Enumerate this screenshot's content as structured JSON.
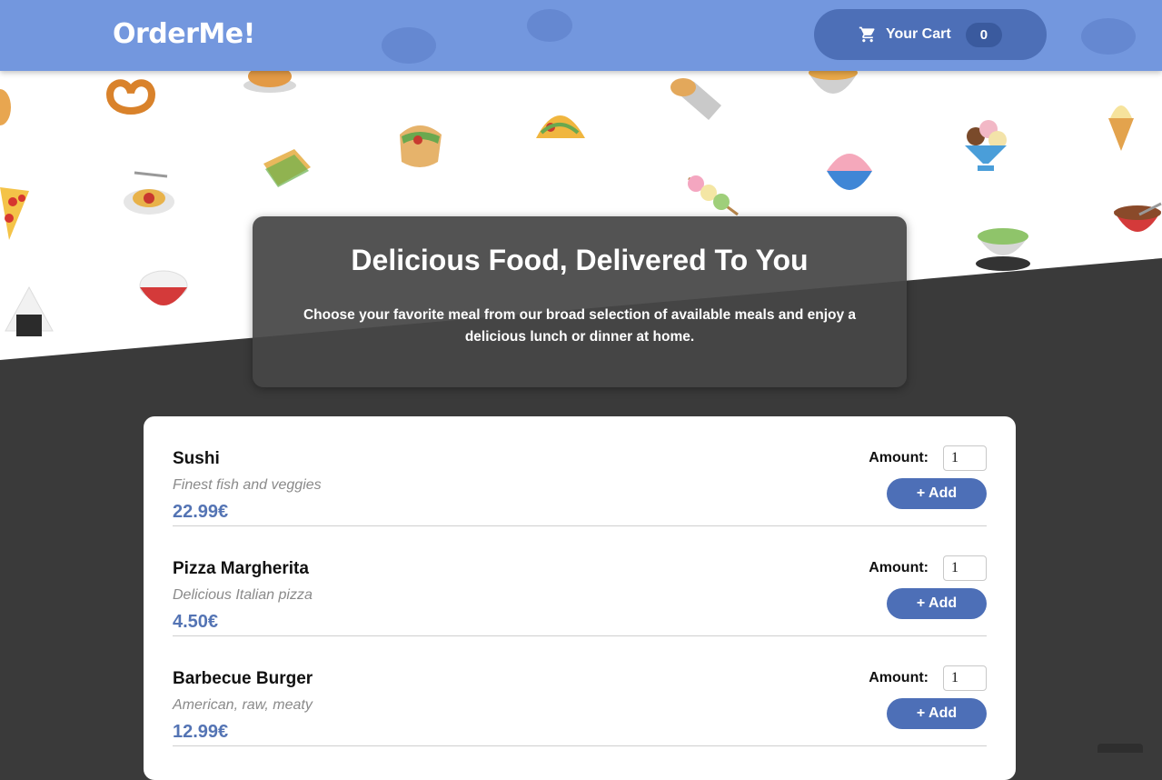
{
  "header": {
    "logo": "OrderMe!",
    "cart": {
      "label": "Your Cart",
      "count": "0",
      "icon": "cart-icon"
    }
  },
  "hero": {
    "title": "Delicious Food, Delivered To You",
    "text": "Choose your favorite meal from our broad selection of available meals and enjoy a delicious lunch or dinner at home."
  },
  "meals": [
    {
      "name": "Sushi",
      "description": "Finest fish and veggies",
      "price": "22.99€",
      "amount_label": "Amount:",
      "amount": "1",
      "add_label": "+ Add"
    },
    {
      "name": "Pizza Margherita",
      "description": "Delicious Italian pizza",
      "price": "4.50€",
      "amount_label": "Amount:",
      "amount": "1",
      "add_label": "+ Add"
    },
    {
      "name": "Barbecue Burger",
      "description": "American, raw, meaty",
      "price": "12.99€",
      "amount_label": "Amount:",
      "amount": "1",
      "add_label": "+ Add"
    }
  ],
  "colors": {
    "header": "#7397de",
    "accent": "#4d6fb7",
    "price": "#5474b4",
    "page_dark": "#3a3a3a"
  }
}
